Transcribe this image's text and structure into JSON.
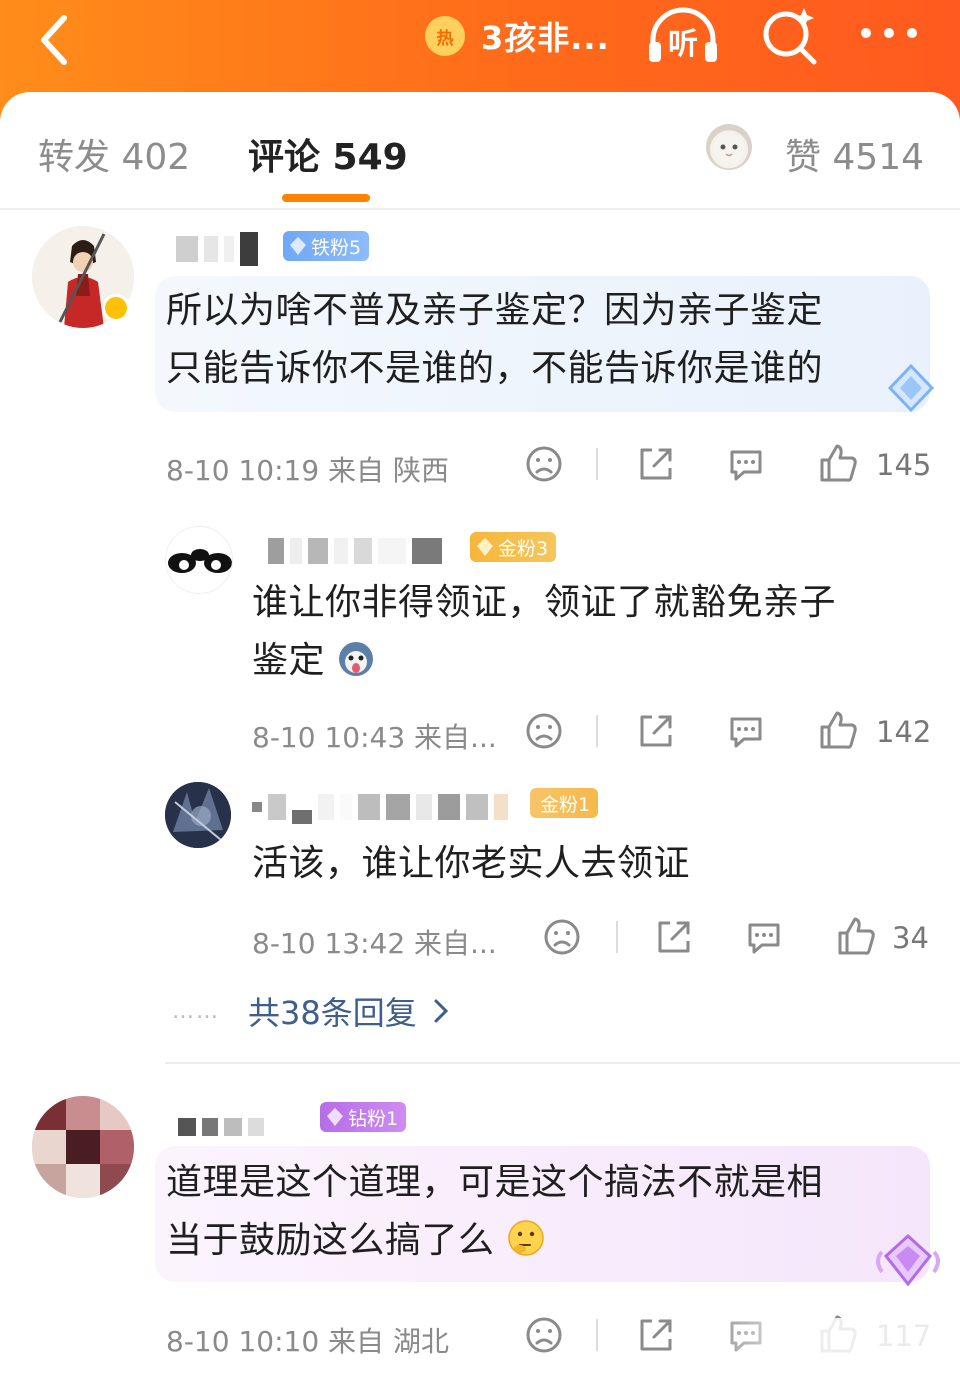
{
  "header": {
    "hot_badge": "热",
    "title": "3孩非...",
    "listen_label": "听",
    "colors": {
      "bar_start": "#ff8d1a",
      "bar_end": "#ff5a1f"
    }
  },
  "tabs": {
    "repost": "转发 402",
    "comments": "评论 549",
    "likes": "赞 4514"
  },
  "comments": [
    {
      "fan_badge": "铁粉5",
      "text_line1": "所以为啥不普及亲子鉴定？因为亲子鉴定",
      "text_line2": "只能告诉你不是谁的，不能告诉你是谁的",
      "meta": "8-10 10:19  来自 陕西",
      "likes": "145",
      "replies": [
        {
          "fan_badge": "金粉3",
          "text_line1": "谁让你非得领证，领证了就豁免亲子",
          "text_line2": "鉴定",
          "meta": "8-10 10:43  来自...",
          "likes": "142"
        },
        {
          "fan_badge": "金粉1",
          "text_line1": "活该，谁让你老实人去领证",
          "meta": "8-10 13:42  来自...",
          "likes": "34"
        }
      ],
      "more_replies": "共38条回复",
      "more_dots": "……"
    },
    {
      "fan_badge": "钻粉1",
      "text_line1": "道理是这个道理，可是这个搞法不就是相",
      "text_line2": "当于鼓励这么搞了么",
      "meta": "8-10 10:10  来自 湖北",
      "likes": "117"
    }
  ],
  "icons": [
    "back-arrow-icon",
    "hot-icon",
    "listen-icon",
    "search-icon",
    "more-icon",
    "sad-face-icon",
    "share-icon",
    "comment-icon",
    "thumbs-up-icon",
    "chevron-right-icon",
    "diamond-frame-icon",
    "dog-emoji-icon",
    "thinking-emoji-icon"
  ]
}
